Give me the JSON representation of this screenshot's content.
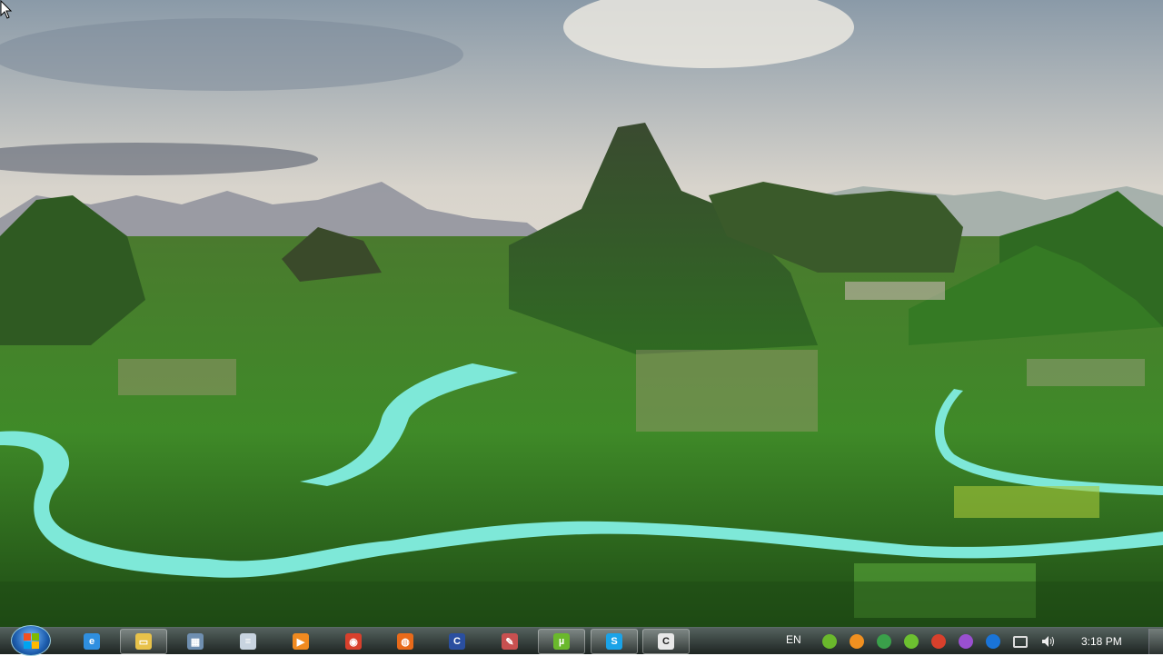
{
  "taskbar": {
    "start_button": "Start",
    "pinned": [
      {
        "name": "internet-explorer",
        "color": "#2f8fe0",
        "glyph": "e",
        "active": false
      },
      {
        "name": "windows-explorer",
        "color": "#e8c24a",
        "glyph": "▭",
        "active": true
      },
      {
        "name": "calculator",
        "color": "#6f8fb0",
        "glyph": "▦",
        "active": false
      },
      {
        "name": "notepad",
        "color": "#c8d4e0",
        "glyph": "≡",
        "active": false
      },
      {
        "name": "media-player",
        "color": "#f08a20",
        "glyph": "▶",
        "active": false
      },
      {
        "name": "chrome",
        "color": "#d8402c",
        "glyph": "◉",
        "active": false
      },
      {
        "name": "firefox",
        "color": "#e86a1a",
        "glyph": "◍",
        "active": false
      },
      {
        "name": "app-shield",
        "color": "#2a4fa0",
        "glyph": "C",
        "active": false
      },
      {
        "name": "paint-app",
        "color": "#c85050",
        "glyph": "✎",
        "active": false
      },
      {
        "name": "utorrent",
        "color": "#6ab82c",
        "glyph": "µ",
        "active": true
      },
      {
        "name": "skype",
        "color": "#1aa3e8",
        "glyph": "S",
        "active": true
      },
      {
        "name": "camtasia",
        "color": "#e8e8e8",
        "glyph": "C",
        "active": true
      }
    ]
  },
  "tray": {
    "language": "EN",
    "icons": [
      {
        "name": "utorrent-tray",
        "color": "#6ab82c"
      },
      {
        "name": "orange-app-tray",
        "color": "#f09020"
      },
      {
        "name": "download-manager-tray",
        "color": "#3aa04a"
      },
      {
        "name": "green-check-tray",
        "color": "#6cc030"
      },
      {
        "name": "chrome-tray",
        "color": "#d8402c"
      },
      {
        "name": "purple-pen-tray",
        "color": "#9a50d0"
      },
      {
        "name": "teamviewer-tray",
        "color": "#1a74d8"
      }
    ],
    "time": "3:18 PM"
  }
}
